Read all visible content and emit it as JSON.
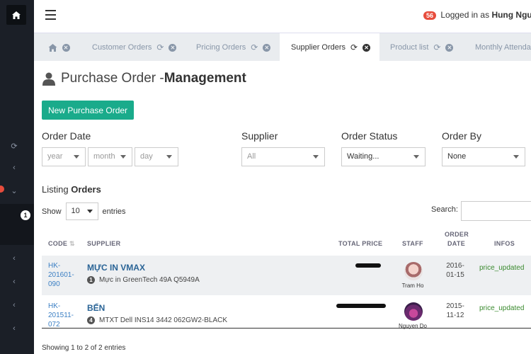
{
  "header": {
    "user_badge_count": "56",
    "logged_in_text": "Logged in as",
    "user_name": "Hung Nguyen"
  },
  "sidebar": {
    "sub_badge": "1"
  },
  "tabs": [
    {
      "label": "",
      "icon": "home-icon"
    },
    {
      "label": "Customer Orders"
    },
    {
      "label": "Pricing Orders"
    },
    {
      "label": "Supplier Orders",
      "active": true
    },
    {
      "label": "Product list"
    },
    {
      "label": "Monthly Attendance"
    }
  ],
  "page": {
    "title_light": "Purchase Order - ",
    "title_bold": "Management",
    "new_button": "New Purchase Order"
  },
  "filters": {
    "order_date_label": "Order Date",
    "year": "year",
    "month": "month",
    "day": "day",
    "supplier_label": "Supplier",
    "supplier_value": "All",
    "status_label": "Order Status",
    "status_value": "Waiting...",
    "order_by_label": "Order By",
    "order_by_value": "None"
  },
  "listing": {
    "title_light": "Listing ",
    "title_bold": "Orders",
    "show_label": "Show",
    "entries_value": "10",
    "entries_label": "entries",
    "search_label": "Search:"
  },
  "table": {
    "headers": {
      "code": "CODE",
      "supplier": "SUPPLIER",
      "total_price": "TOTAL PRICE",
      "staff": "STAFF",
      "order": "ORDER",
      "date": "DATE",
      "infos": "INFOS"
    },
    "rows": [
      {
        "code1": "HK-",
        "code2": "201601-",
        "code3": "090",
        "supplier": "MỰC IN VMAX",
        "item_qty": "1",
        "item": "Mực in GreenTech 49A Q5949A",
        "staff": "Tram Ho",
        "date1": "2016-",
        "date2": "01-15",
        "info": "price_updated"
      },
      {
        "code1": "HK-",
        "code2": "201511-",
        "code3": "072",
        "supplier": "BẾN",
        "item_qty": "4",
        "item": "MTXT Dell INS14 3442 062GW2-BLACK",
        "staff": "Nguyen Do",
        "date1": "2015-",
        "date2": "11-12",
        "info": "price_updated"
      }
    ]
  },
  "footer": {
    "info": "Showing 1 to 2 of 2 entries"
  }
}
